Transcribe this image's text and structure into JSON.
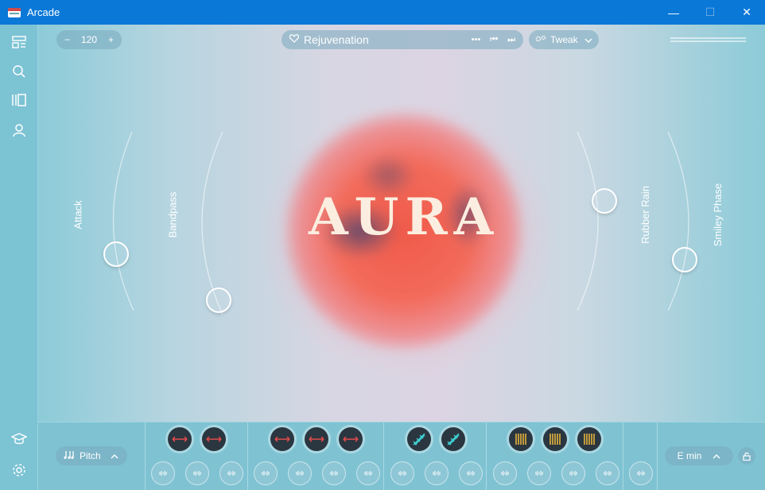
{
  "window": {
    "title": "Arcade",
    "minimize": "—",
    "maximize": "☐",
    "close": "✕"
  },
  "sidebar": {
    "items": [
      "layout-icon",
      "search-icon",
      "library-icon",
      "user-icon",
      "learn-icon",
      "settings-icon"
    ]
  },
  "top": {
    "tempo": {
      "minus": "−",
      "value": "120",
      "plus": "+"
    },
    "preset": {
      "name": "Rejuvenation",
      "more": "•••",
      "prev": "⏮",
      "next": "⏭"
    },
    "tweak": {
      "label": "Tweak"
    }
  },
  "logo": "AURA",
  "knobs": {
    "attack": "Attack",
    "bandpass": "Bandpass",
    "rubber_rain": "Rubber Rain",
    "smiley_phase": "Smiley Phase"
  },
  "bottom": {
    "pitch": {
      "label": "Pitch"
    },
    "key": {
      "label": "E min"
    }
  },
  "colors": {
    "titlebar": "#0a78d7",
    "accent_red": "#e34b4b",
    "accent_teal": "#3fd3d6",
    "accent_gold": "#e6b23c"
  }
}
